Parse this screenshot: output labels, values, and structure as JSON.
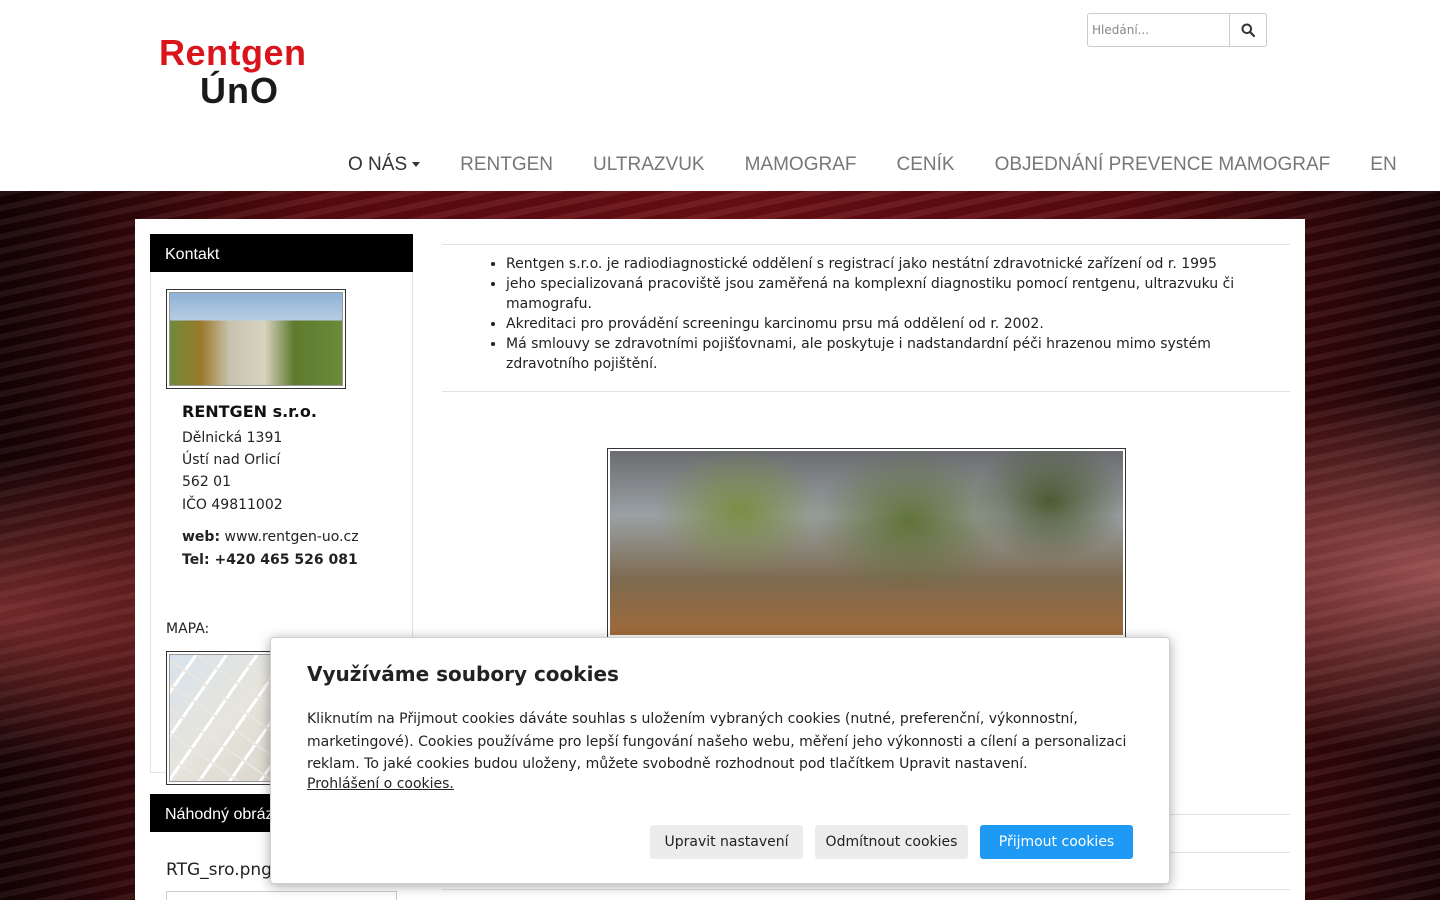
{
  "logo": {
    "line1": "Rentgen",
    "line2": "ÚnO"
  },
  "search": {
    "placeholder": "Hledání...",
    "icon": "search-icon"
  },
  "nav": {
    "items": [
      {
        "label": "O NÁS",
        "dropdown": true
      },
      {
        "label": "RENTGEN"
      },
      {
        "label": "ULTRAZVUK"
      },
      {
        "label": "MAMOGRAF"
      },
      {
        "label": "CENÍK"
      },
      {
        "label": "OBJEDNÁNÍ PREVENCE MAMOGRAF"
      },
      {
        "label": "EN"
      }
    ]
  },
  "sidebar": {
    "contact_title": "Kontakt",
    "company": "RENTGEN s.r.o.",
    "street": "Dělnická 1391",
    "city": "Ústí nad Orlicí",
    "zip": "562 01",
    "ico": "IČO 49811002",
    "web_label": "web:",
    "web_value": "www.rentgen-uo.cz",
    "tel": "Tel: +420 465 526 081",
    "map_label": "MAPA:",
    "random_image_title": "Náhodný obrázek",
    "random_image_name": "RTG_sro.png"
  },
  "content": {
    "bullets": [
      "Rentgen s.r.o. je radiodiagnostické oddělení s registrací jako nestátní zdravotnické zařízení od r. 1995",
      "jeho specializovaná pracoviště jsou zaměřená na komplexní diagnostiku pomocí rentgenu, ultrazvuku či mamografu.",
      "Akreditaci pro provádění screeningu karcinomu prsu má oddělení od r. 2002.",
      "Má smlouvy se zdravotními pojišťovnami, ale poskytuje i nadstandardní péči hrazenou mimo systém zdravotního pojištění."
    ]
  },
  "cookie": {
    "title": "Využíváme soubory cookies",
    "text": "Kliknutím na Přijmout cookies dáváte souhlas s uložením vybraných cookies (nutné, preferenční, výkonnostní, marketingové). Cookies používáme pro lepší fungování našeho webu, měření jeho výkonnosti a cílení a personalizaci reklam. To jaké cookies budou uloženy, můžete svobodně rozhodnout pod tlačítkem Upravit nastavení.",
    "link": "Prohlášení o cookies.",
    "btn_settings": "Upravit nastavení",
    "btn_reject": "Odmítnout cookies",
    "btn_accept": "Přijmout cookies"
  },
  "colors": {
    "brand_red": "#d9141b",
    "accept_blue": "#1e9af5",
    "panel_head": "#000000"
  }
}
